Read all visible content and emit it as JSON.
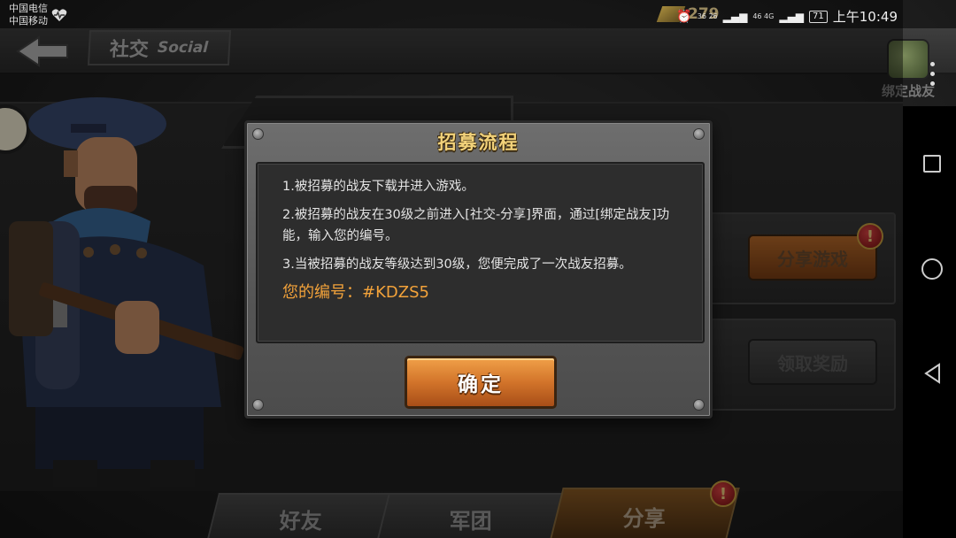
{
  "status_bar": {
    "carrier_1": "中国电信",
    "carrier_2": "中国移动",
    "signal_1": "36 26",
    "signal_2": "46 4G",
    "battery": "71",
    "time": "上午10:49"
  },
  "header": {
    "title_cn": "社交",
    "title_en": "Social",
    "gold": "279",
    "bind_friend_label": "绑定战友"
  },
  "side_panel": {
    "share_game_label": "分享游戏",
    "claim_reward_label": "领取奖励",
    "alert_glyph": "!"
  },
  "tabs": [
    {
      "label": "好友",
      "active": false
    },
    {
      "label": "军团",
      "active": false
    },
    {
      "label": "分享",
      "active": true
    }
  ],
  "modal": {
    "title": "招募流程",
    "steps": [
      "1.被招募的战友下载并进入游戏。",
      "2.被招募的战友在30级之前进入[社交-分享]界面，通过[绑定战友]功能，输入您的编号。",
      "3.当被招募的战友等级达到30级，您便完成了一次战友招募。"
    ],
    "code_line": "您的编号：#KDZS5",
    "confirm_label": "确定"
  },
  "colors": {
    "accent_orange": "#d2742a",
    "code_text": "#f2a23a",
    "title_gold": "#f2d27a"
  }
}
